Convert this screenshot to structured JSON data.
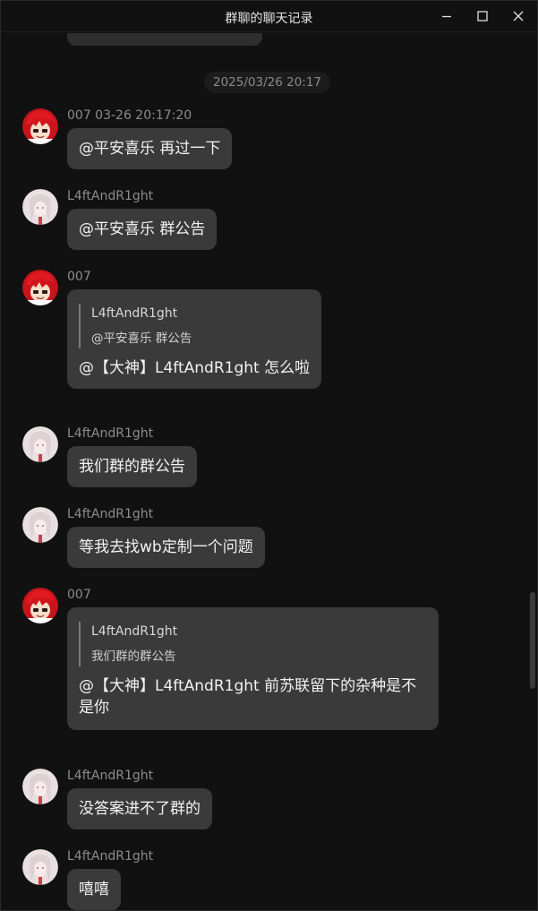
{
  "window": {
    "title": "群聊的聊天记录",
    "controls": [
      "minimize-icon",
      "maximize-icon",
      "close-icon"
    ]
  },
  "time_separator": "2025/03/26 20:17",
  "messages": [
    {
      "sender": "007 03-26 20:17:20",
      "avatar": "red-hair-avatar",
      "text": "@平安喜乐 再过一下"
    },
    {
      "sender": "L4ftAndR1ght",
      "avatar": "white-hair-avatar",
      "text": "@平安喜乐 群公告"
    },
    {
      "sender": "007",
      "avatar": "red-hair-avatar",
      "quote_name": "L4ftAndR1ght",
      "quote_text": "@平安喜乐 群公告",
      "text": "@【大神】L4ftAndR1ght 怎么啦"
    },
    {
      "sender": "L4ftAndR1ght",
      "avatar": "white-hair-avatar",
      "text": "我们群的群公告"
    },
    {
      "sender": "L4ftAndR1ght",
      "avatar": "white-hair-avatar",
      "text": "等我去找wb定制一个问题"
    },
    {
      "sender": "007",
      "avatar": "red-hair-avatar",
      "quote_name": "L4ftAndR1ght",
      "quote_text": "我们群的群公告",
      "text_line1": "@【大神】L4ftAndR1ght 前苏联留下的杂种是不",
      "text_line2": "是你"
    },
    {
      "sender": "L4ftAndR1ght",
      "avatar": "white-hair-avatar",
      "text": "没答案进不了群的"
    },
    {
      "sender": "L4ftAndR1ght",
      "avatar": "white-hair-avatar",
      "text": "嘻嘻"
    }
  ],
  "colors": {
    "background": "#111111",
    "bubble": "#3a3a3a",
    "sender_text": "#8c8c8c",
    "red_avatar": "#c8141c",
    "white_avatar": "#e9dfe0"
  }
}
